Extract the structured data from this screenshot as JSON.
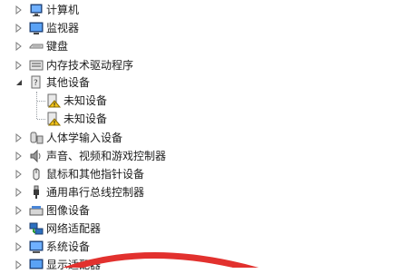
{
  "tree": {
    "computer": "计算机",
    "monitors": "监视器",
    "keyboard": "键盘",
    "memory_tech": "内存技术驱动程序",
    "other_devices": "其他设备",
    "unknown_1": "未知设备",
    "unknown_2": "未知设备",
    "hid": "人体学输入设备",
    "sound": "声音、视频和游戏控制器",
    "mouse": "鼠标和其他指针设备",
    "usb": "通用串行总线控制器",
    "imaging": "图像设备",
    "network": "网络适配器",
    "system": "系统设备",
    "display": "显示适配器"
  },
  "colors": {
    "annotation": "#e2312e",
    "warning": "#f5c518",
    "arrow": "#5a5a5a"
  }
}
